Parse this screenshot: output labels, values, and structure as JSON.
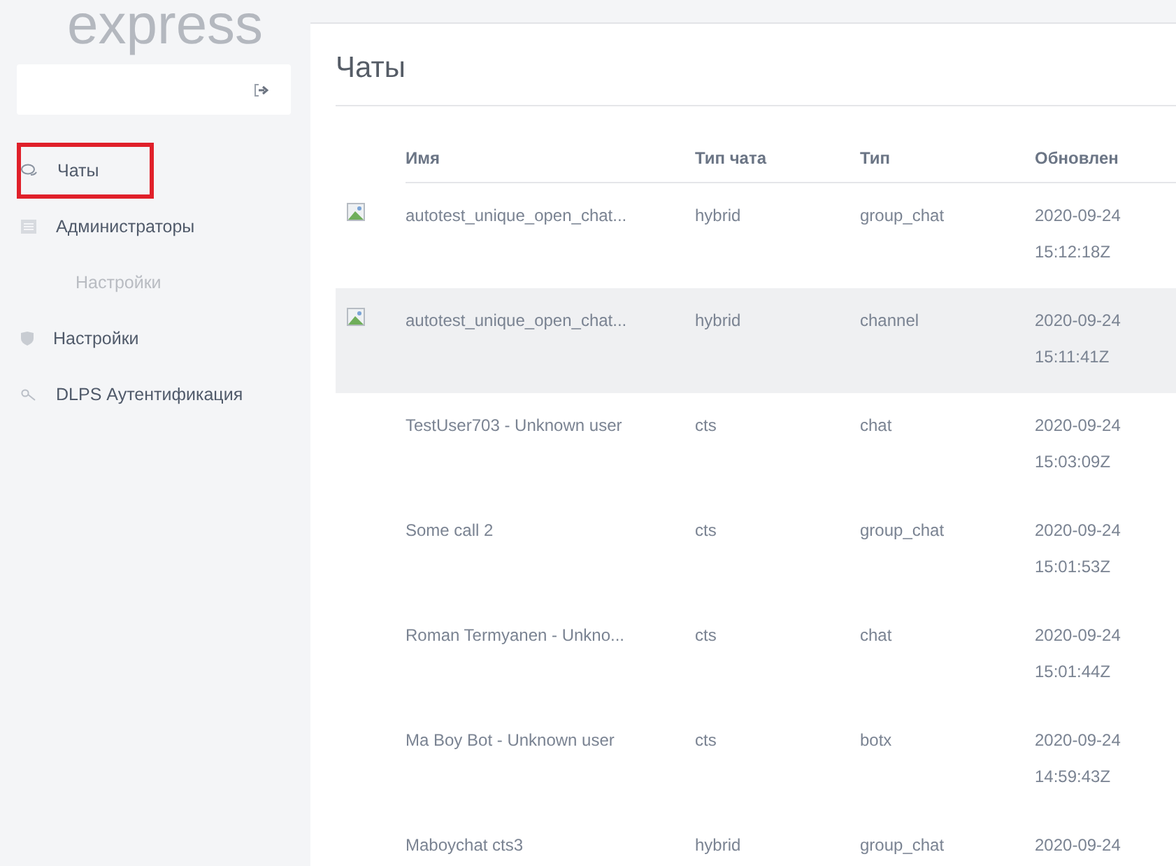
{
  "logo": {
    "text": "express"
  },
  "sidebar": {
    "items": [
      {
        "kind": "nav",
        "label": "Чаты",
        "selected": true
      },
      {
        "kind": "nav",
        "label": "Администраторы",
        "selected": false
      },
      {
        "kind": "sub",
        "label": "Настройки",
        "selected": false
      },
      {
        "kind": "nav",
        "label": "Настройки",
        "selected": false
      },
      {
        "kind": "nav",
        "label": "DLPS Аутентификация",
        "selected": false
      }
    ]
  },
  "page": {
    "title": "Чаты"
  },
  "table": {
    "columns": [
      "Имя",
      "Тип чата",
      "Тип",
      "Обновлен"
    ],
    "rows": [
      {
        "image": true,
        "highlighted": false,
        "name": "autotest_unique_open_chat...",
        "chat_type": "hybrid",
        "type": "group_chat",
        "date": "2020-09-24",
        "time": "15:12:18Z"
      },
      {
        "image": true,
        "highlighted": true,
        "name": "autotest_unique_open_chat...",
        "chat_type": "hybrid",
        "type": "channel",
        "date": "2020-09-24",
        "time": "15:11:41Z"
      },
      {
        "image": false,
        "highlighted": false,
        "name": "TestUser703 - Unknown user",
        "chat_type": "cts",
        "type": "chat",
        "date": "2020-09-24",
        "time": "15:03:09Z"
      },
      {
        "image": false,
        "highlighted": false,
        "name": "Some call 2",
        "chat_type": "cts",
        "type": "group_chat",
        "date": "2020-09-24",
        "time": "15:01:53Z"
      },
      {
        "image": false,
        "highlighted": false,
        "name": "Roman Termyanen - Unkno...",
        "chat_type": "cts",
        "type": "chat",
        "date": "2020-09-24",
        "time": "15:01:44Z"
      },
      {
        "image": false,
        "highlighted": false,
        "name": "Ma Boy Bot - Unknown user",
        "chat_type": "cts",
        "type": "botx",
        "date": "2020-09-24",
        "time": "14:59:43Z"
      },
      {
        "image": false,
        "highlighted": false,
        "name": "Maboychat cts3",
        "chat_type": "hybrid",
        "type": "group_chat",
        "date": "2020-09-24"
      }
    ]
  }
}
